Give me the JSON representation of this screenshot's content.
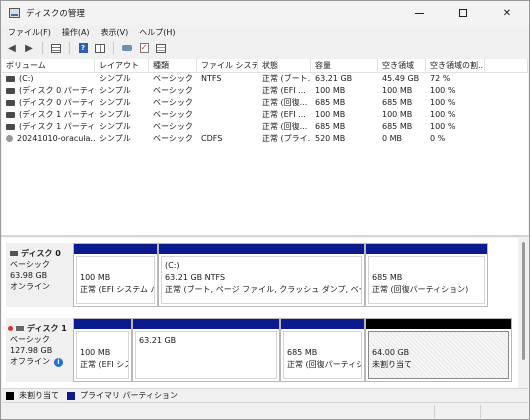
{
  "window": {
    "title": "ディスクの管理"
  },
  "menu": [
    "ファイル(F)",
    "操作(A)",
    "表示(V)",
    "ヘルプ(H)"
  ],
  "toolbar": {
    "icons": [
      "back-arrow-icon",
      "forward-arrow-icon",
      "volume-list-icon",
      "help-icon",
      "split-pane-icon",
      "key-icon",
      "checklist-icon",
      "properties-icon"
    ]
  },
  "columns": [
    "ボリューム",
    "レイアウト",
    "種類",
    "ファイル システム",
    "状態",
    "容量",
    "空き領域",
    "空き領域の割..."
  ],
  "volumes": [
    [
      "(C:)",
      "シンプル",
      "ベーシック",
      "NTFS",
      "正常 (ブート...",
      "63.21 GB",
      "45.49 GB",
      "72 %"
    ],
    [
      "(ディスク 0 パーティシ...",
      "シンプル",
      "ベーシック",
      "",
      "正常 (EFI ...",
      "100 MB",
      "100 MB",
      "100 %"
    ],
    [
      "(ディスク 0 パーティシ...",
      "シンプル",
      "ベーシック",
      "",
      "正常 (回復...",
      "685 MB",
      "685 MB",
      "100 %"
    ],
    [
      "(ディスク 1 パーティシ...",
      "シンプル",
      "ベーシック",
      "",
      "正常 (EFI ...",
      "100 MB",
      "100 MB",
      "100 %"
    ],
    [
      "(ディスク 1 パーティシ...",
      "シンプル",
      "ベーシック",
      "",
      "正常 (回復...",
      "685 MB",
      "685 MB",
      "100 %"
    ],
    [
      "20241010-oracula...",
      "シンプル",
      "ベーシック",
      "CDFS",
      "正常 (プライ...",
      "520 MB",
      "0 MB",
      "0 %"
    ]
  ],
  "disks": [
    {
      "name": "ディスク 0",
      "type": "ベーシック",
      "size": "63.98 GB",
      "status": "オンライン",
      "partitions": [
        {
          "line1": "100 MB",
          "line2": "正常 (EFI システム パーティション)"
        },
        {
          "line0": "(C:)",
          "line1": "63.21 GB NTFS",
          "line2": "正常 (ブート, ページ ファイル, クラッシュ ダンプ, ベーシック データ パーティション)"
        },
        {
          "line1": "685 MB",
          "line2": "正常 (回復パーティション)"
        }
      ]
    },
    {
      "name": "ディスク 1",
      "type": "ベーシック",
      "size": "127.98 GB",
      "status": "オフライン",
      "partitions": [
        {
          "line1": "100 MB",
          "line2": "正常 (EFI システム パーティション)"
        },
        {
          "line1": "63.21 GB",
          "line2": ""
        },
        {
          "line1": "685 MB",
          "line2": "正常 (回復パーティション)"
        },
        {
          "line1": "64.00 GB",
          "line2": "未割り当て"
        }
      ]
    }
  ],
  "legend": [
    {
      "label": "未割り当て",
      "color": "#000000"
    },
    {
      "label": "プライマリ パーティション",
      "color": "#0b1a8c"
    }
  ]
}
